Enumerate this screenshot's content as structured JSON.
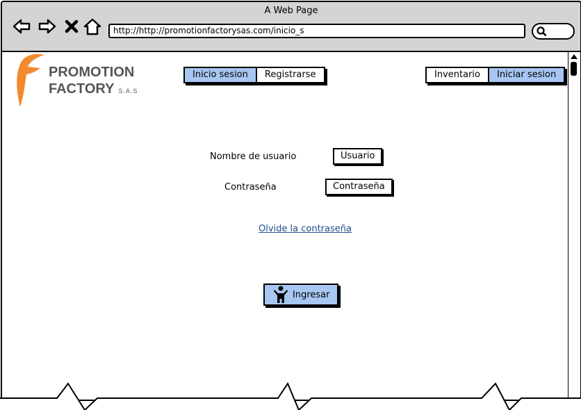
{
  "window": {
    "title": "A Web Page"
  },
  "browser": {
    "url": "http://http://promotionfactorysas.com/inicio_s"
  },
  "logo": {
    "line1": "PROMOTION",
    "line2": "FACTORY",
    "suffix": "S.A.S",
    "accent_color": "#f28a2e"
  },
  "nav_left": {
    "items": [
      {
        "label": "Inicio sesion",
        "active": true
      },
      {
        "label": "Registrarse",
        "active": false
      }
    ]
  },
  "nav_right": {
    "items": [
      {
        "label": "Inventario",
        "active": false
      },
      {
        "label": "Iniciar sesion",
        "active": true
      }
    ]
  },
  "form": {
    "username_label": "Nombre de usuario",
    "username_value": "Usuario",
    "password_label": "Contraseña",
    "password_value": "Contraseña",
    "forgot_link": "Olvide la contraseña",
    "submit_label": "Ingresar"
  },
  "icons": [
    "back-arrow-icon",
    "forward-arrow-icon",
    "close-icon",
    "home-icon",
    "search-icon",
    "user-icon",
    "scroll-up-icon"
  ],
  "colors": {
    "active_button": "#a8c6f2",
    "link": "#1f4e8c",
    "chrome": "#d4d4d4"
  }
}
